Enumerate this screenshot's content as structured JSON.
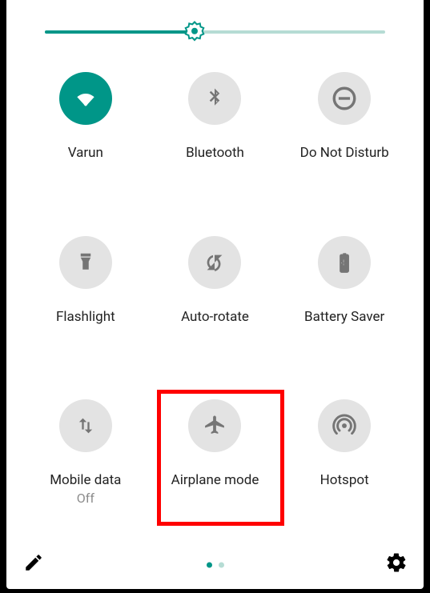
{
  "brightness": {
    "percent": 44
  },
  "accent_color": "#009688",
  "tiles": [
    {
      "label": "Varun",
      "icon": "wifi",
      "active": true
    },
    {
      "label": "Bluetooth",
      "icon": "bluetooth",
      "active": false
    },
    {
      "label": "Do Not Disturb",
      "icon": "dnd",
      "active": false
    },
    {
      "label": "Flashlight",
      "icon": "flashlight",
      "active": false
    },
    {
      "label": "Auto-rotate",
      "icon": "autorotate",
      "active": false
    },
    {
      "label": "Battery Saver",
      "icon": "battery",
      "active": false
    },
    {
      "label": "Mobile data",
      "sublabel": "Off",
      "icon": "mobiledata",
      "active": false
    },
    {
      "label": "Airplane mode",
      "icon": "airplane",
      "active": false,
      "highlighted": true
    },
    {
      "label": "Hotspot",
      "icon": "hotspot",
      "active": false
    }
  ],
  "pager": {
    "pages": 2,
    "current": 0
  }
}
